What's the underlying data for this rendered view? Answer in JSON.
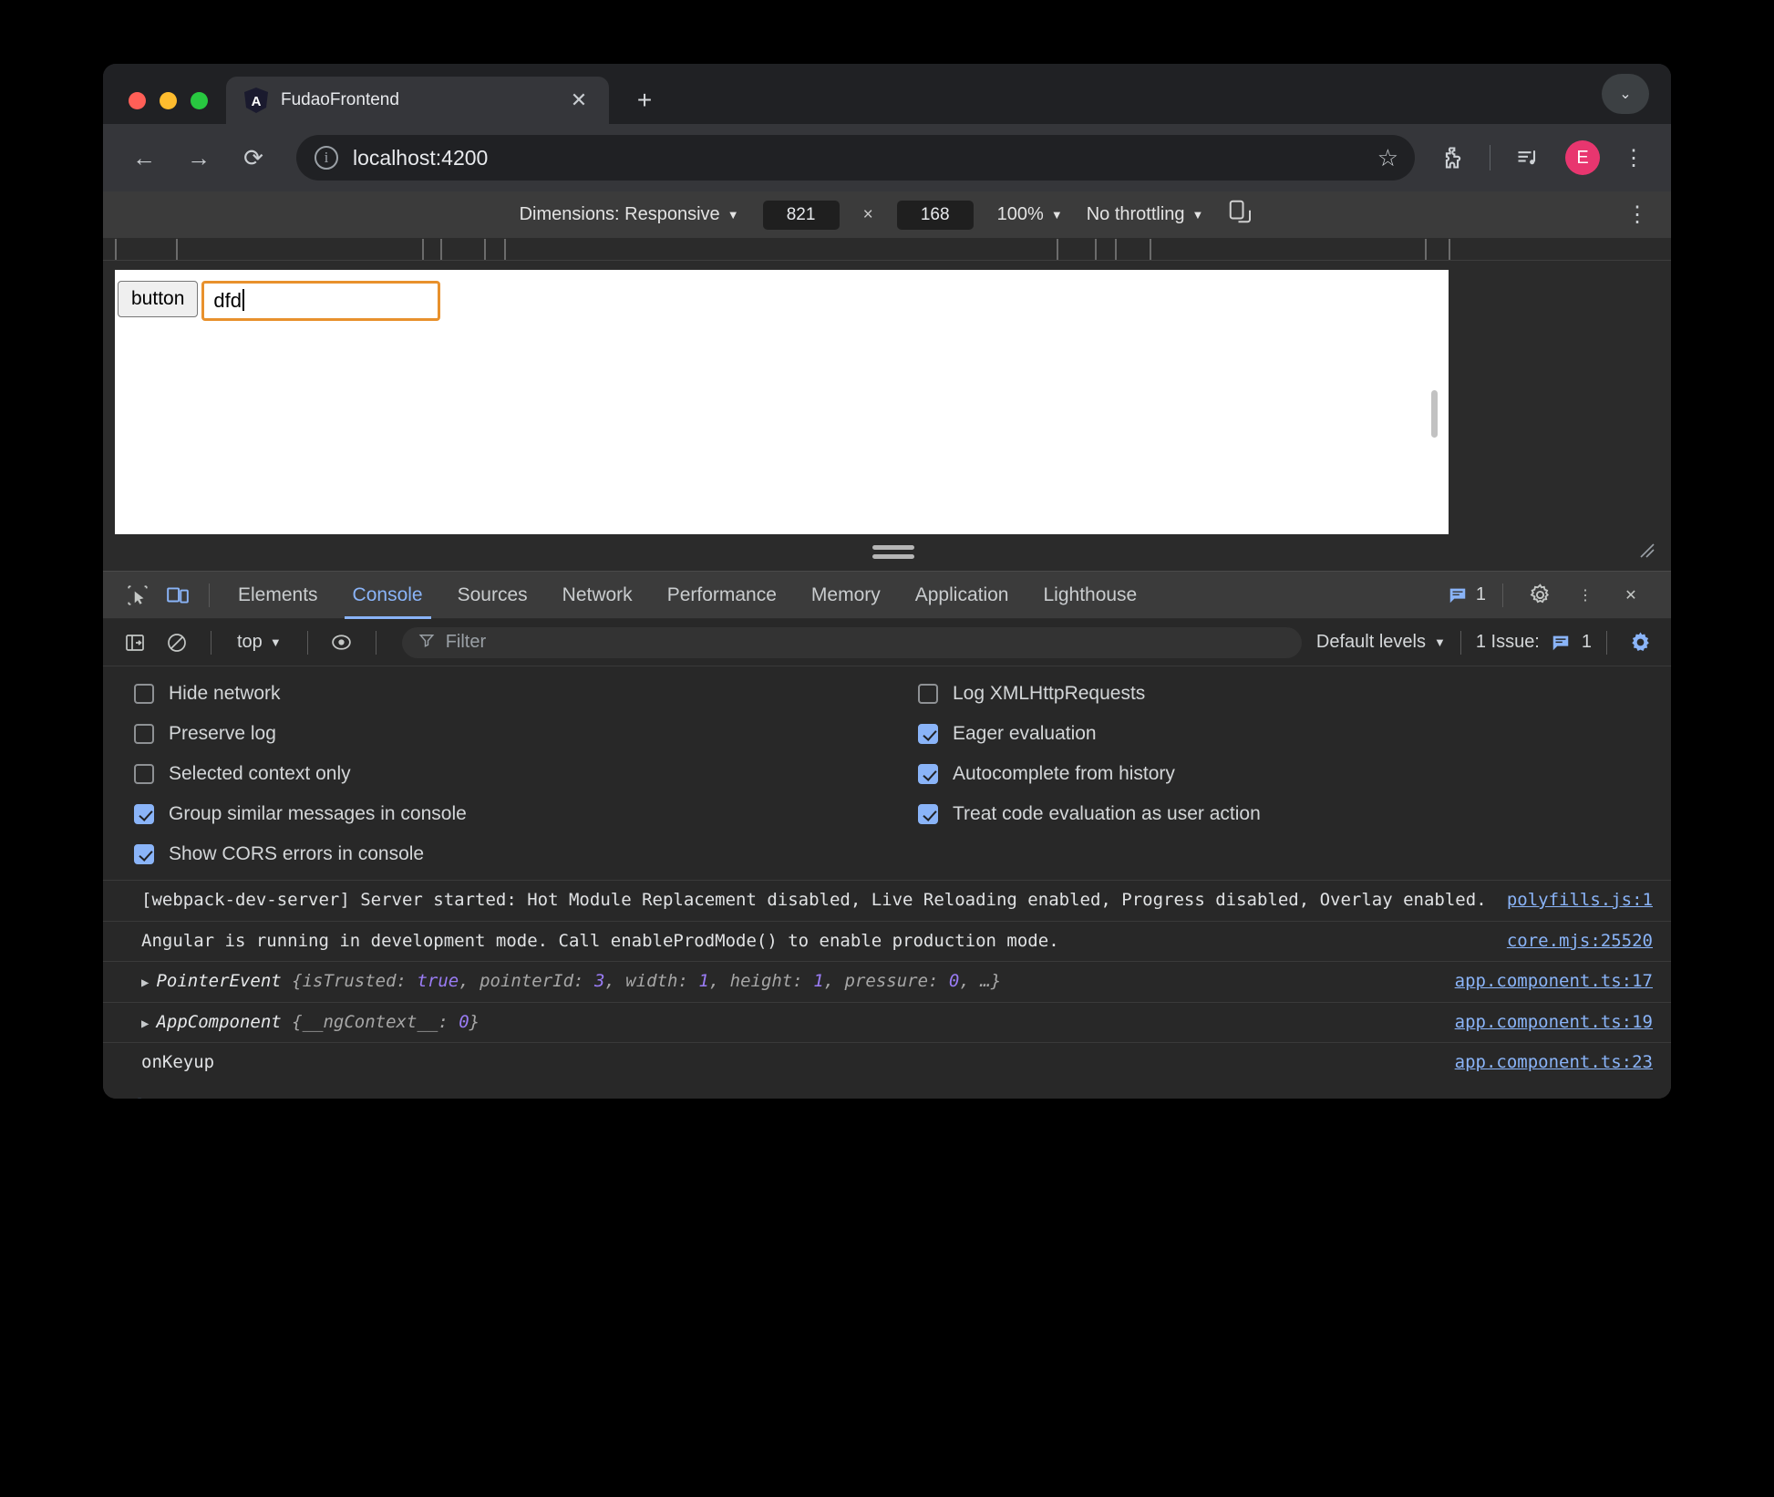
{
  "browser": {
    "tab": {
      "title": "FudaoFrontend",
      "close_label": "✕",
      "favicon": "angular-logo"
    },
    "new_tab_label": "+",
    "tab_list_chevron": "⌄",
    "nav": {
      "back": "←",
      "forward": "→",
      "reload": "⟳"
    },
    "omnibox": {
      "url": "localhost:4200",
      "info_icon": "ⓘ",
      "bookmark_icon": "☆"
    },
    "toolbar_icons": {
      "extensions": "puzzle-icon",
      "media": "media-icon",
      "profile_initial": "E",
      "menu": "⋮"
    }
  },
  "device_toolbar": {
    "dimensions_label": "Dimensions: Responsive",
    "width": "821",
    "height": "168",
    "times": "×",
    "zoom": "100%",
    "throttling": "No throttling",
    "caret": "▼",
    "rotate_icon": "rotate-icon",
    "more_icon": "⋮"
  },
  "page": {
    "button_label": "button",
    "input_value": "dfd"
  },
  "devtools": {
    "tabs": [
      {
        "label": "Elements",
        "active": false
      },
      {
        "label": "Console",
        "active": true
      },
      {
        "label": "Sources",
        "active": false
      },
      {
        "label": "Network",
        "active": false
      },
      {
        "label": "Performance",
        "active": false
      },
      {
        "label": "Memory",
        "active": false
      },
      {
        "label": "Application",
        "active": false
      },
      {
        "label": "Lighthouse",
        "active": false
      }
    ],
    "tab_icons": {
      "inspect": "inspect-icon",
      "device": "device-toggle-icon"
    },
    "tabs_right": {
      "issues_count": "1",
      "settings_icon": "gear-icon",
      "more_icon": "⋮",
      "close_icon": "✕"
    },
    "filterbar": {
      "sidebar_icon": "sidebar-toggle-icon",
      "clear_icon": "clear-console-icon",
      "context": "top",
      "context_caret": "▼",
      "eye_icon": "live-expression-icon",
      "filter_placeholder": "Filter",
      "filter_icon": "filter-icon",
      "levels_label": "Default levels",
      "levels_caret": "▼",
      "issue_label": "1 Issue:",
      "issue_count": "1",
      "settings_gear": "gear-icon"
    },
    "settings": {
      "left": [
        {
          "label": "Hide network",
          "checked": false
        },
        {
          "label": "Preserve log",
          "checked": false
        },
        {
          "label": "Selected context only",
          "checked": false
        },
        {
          "label": "Group similar messages in console",
          "checked": true
        },
        {
          "label": "Show CORS errors in console",
          "checked": true
        }
      ],
      "right": [
        {
          "label": "Log XMLHttpRequests",
          "checked": false
        },
        {
          "label": "Eager evaluation",
          "checked": true
        },
        {
          "label": "Autocomplete from history",
          "checked": true
        },
        {
          "label": "Treat code evaluation as user action",
          "checked": true
        }
      ]
    },
    "messages": [
      {
        "kind": "text",
        "text": "[webpack-dev-server] Server started: Hot Module Replacement disabled, Live Reloading enabled, Progress disabled, Overlay enabled.",
        "source": "polyfills.js:1"
      },
      {
        "kind": "text",
        "text": "Angular is running in development mode. Call enableProdMode() to enable production mode.",
        "source": "core.mjs:25520"
      },
      {
        "kind": "object",
        "arrow": "▶",
        "name": "PointerEvent",
        "source": "app.component.ts:17",
        "props": [
          {
            "key": "{isTrusted: ",
            "val": "true"
          },
          {
            "key": ", pointerId: ",
            "val": "3"
          },
          {
            "key": ", width: ",
            "val": "1"
          },
          {
            "key": ", height: ",
            "val": "1"
          },
          {
            "key": ", pressure: ",
            "val": "0"
          },
          {
            "key": ", …}",
            "val": ""
          }
        ]
      },
      {
        "kind": "object",
        "arrow": "▶",
        "name": "AppComponent",
        "source": "app.component.ts:19",
        "props": [
          {
            "key": "{__ngContext__: ",
            "val": "0"
          },
          {
            "key": "}",
            "val": ""
          }
        ]
      },
      {
        "kind": "text",
        "text": "onKeyup",
        "source": "app.component.ts:23"
      }
    ],
    "prompt_symbol": "❯"
  },
  "colors": {
    "accent_blue": "#8ab4f8",
    "focus_orange": "#e8912d",
    "avatar_pink": "#e8366f",
    "value_purple": "#9a7cf5"
  }
}
